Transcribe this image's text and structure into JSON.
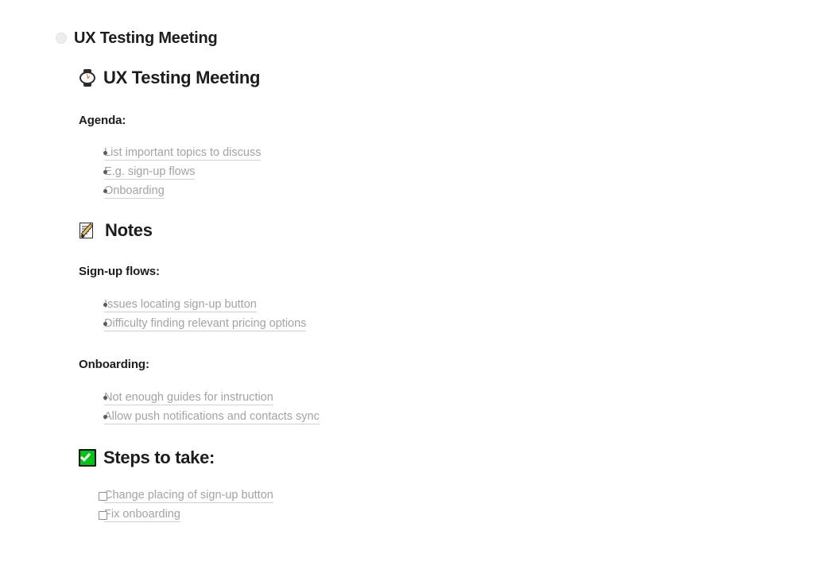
{
  "page": {
    "toggle_icon": "circle-toggle",
    "title": "UX Testing Meeting"
  },
  "document": {
    "title_icon": "watch-icon",
    "title": "UX Testing Meeting",
    "sections": [
      {
        "id": "agenda",
        "heading": "Agenda:",
        "heading_level": "sub",
        "icon": null,
        "list_type": "bullet",
        "items": [
          "List important topics to discuss",
          "E.g. sign-up flows",
          "Onboarding"
        ]
      },
      {
        "id": "notes",
        "heading": "Notes",
        "heading_level": "big",
        "icon": "memo-icon",
        "list_type": "none",
        "items": []
      },
      {
        "id": "sign-up-flows",
        "heading": "Sign-up flows:",
        "heading_level": "sub",
        "icon": null,
        "list_type": "bullet",
        "items": [
          "Issues locating sign-up button",
          "Difficulty finding relevant pricing options"
        ]
      },
      {
        "id": "onboarding",
        "heading": "Onboarding:",
        "heading_level": "sub",
        "icon": null,
        "list_type": "bullet",
        "items": [
          "Not enough guides for instruction",
          "Allow push notifications and contacts sync"
        ]
      },
      {
        "id": "steps-to-take",
        "heading": "Steps to take:",
        "heading_level": "big",
        "icon": "white-check-mark-icon",
        "list_type": "checkbox",
        "items": [
          {
            "label": "Change placing of sign-up button",
            "checked": false
          },
          {
            "label": "Fix onboarding",
            "checked": false
          }
        ]
      }
    ]
  },
  "colors": {
    "background": "#ffffff",
    "heading_text": "#1d1d1d",
    "muted_text": "#a3a3a3",
    "underline": "#cfcfcf",
    "bullet": "#595959",
    "checkbox_border": "#8f8f8f",
    "check_green": "#00c514",
    "toggle_circle": "#ededed"
  }
}
